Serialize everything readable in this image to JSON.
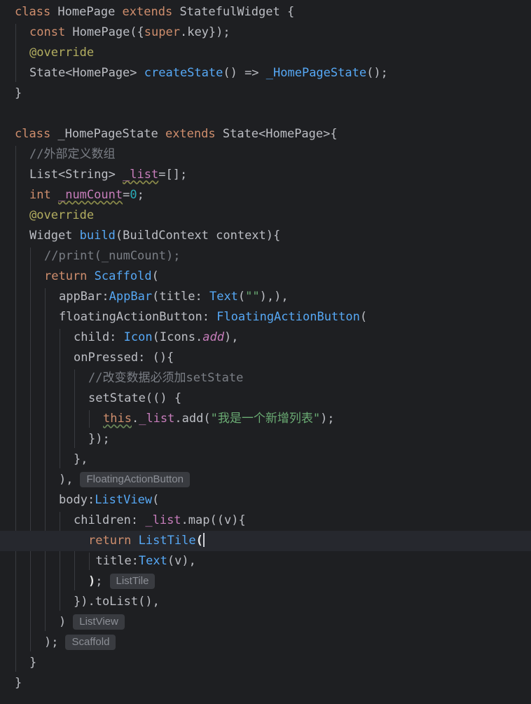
{
  "editor": {
    "lines": [
      {
        "indent": 0,
        "tokens": [
          [
            "kw",
            "class"
          ],
          [
            "plain",
            " HomePage "
          ],
          [
            "kw",
            "extends"
          ],
          [
            "plain",
            " StatefulWidget {"
          ]
        ]
      },
      {
        "indent": 1,
        "tokens": [
          [
            "kw",
            "const"
          ],
          [
            "plain",
            " HomePage({"
          ],
          [
            "kw",
            "super"
          ],
          [
            "plain",
            ".key});"
          ]
        ]
      },
      {
        "indent": 1,
        "tokens": [
          [
            "anno",
            "@override"
          ]
        ]
      },
      {
        "indent": 1,
        "tokens": [
          [
            "plain",
            "State<HomePage> "
          ],
          [
            "fn",
            "createState"
          ],
          [
            "plain",
            "() => "
          ],
          [
            "cls",
            "_HomePageState"
          ],
          [
            "plain",
            "();"
          ]
        ]
      },
      {
        "indent": 0,
        "tokens": [
          [
            "plain",
            "}"
          ]
        ]
      },
      {
        "indent": 0,
        "tokens": []
      },
      {
        "indent": 0,
        "tokens": [
          [
            "kw",
            "class"
          ],
          [
            "plain",
            " _HomePageState "
          ],
          [
            "kw",
            "extends"
          ],
          [
            "plain",
            " State<HomePage>{"
          ]
        ]
      },
      {
        "indent": 1,
        "tokens": [
          [
            "comment",
            "//外部定义数组"
          ]
        ]
      },
      {
        "indent": 1,
        "tokens": [
          [
            "plain",
            "List<String> "
          ],
          [
            "warnfield",
            "_list"
          ],
          [
            "plain",
            "=[];"
          ]
        ]
      },
      {
        "indent": 1,
        "tokens": [
          [
            "kw",
            "int"
          ],
          [
            "plain",
            " "
          ],
          [
            "warnfield",
            "_numCount"
          ],
          [
            "plain",
            "="
          ],
          [
            "num",
            "0"
          ],
          [
            "plain",
            ";"
          ]
        ]
      },
      {
        "indent": 1,
        "tokens": [
          [
            "anno",
            "@override"
          ]
        ]
      },
      {
        "indent": 1,
        "tokens": [
          [
            "plain",
            "Widget "
          ],
          [
            "fn",
            "build"
          ],
          [
            "plain",
            "(BuildContext context){"
          ]
        ]
      },
      {
        "indent": 2,
        "tokens": [
          [
            "comment",
            "//print(_numCount);"
          ]
        ]
      },
      {
        "indent": 2,
        "tokens": [
          [
            "kw",
            "return"
          ],
          [
            "plain",
            " "
          ],
          [
            "cls",
            "Scaffold"
          ],
          [
            "plain",
            "("
          ]
        ]
      },
      {
        "indent": 3,
        "tokens": [
          [
            "plain",
            "appBar:"
          ],
          [
            "cls",
            "AppBar"
          ],
          [
            "plain",
            "(title: "
          ],
          [
            "cls",
            "Text"
          ],
          [
            "plain",
            "("
          ],
          [
            "str",
            "\"\""
          ],
          [
            "plain",
            "),),"
          ]
        ]
      },
      {
        "indent": 3,
        "tokens": [
          [
            "plain",
            "floatingActionButton: "
          ],
          [
            "cls",
            "FloatingActionButton"
          ],
          [
            "plain",
            "("
          ]
        ]
      },
      {
        "indent": 4,
        "tokens": [
          [
            "plain",
            "child: "
          ],
          [
            "cls",
            "Icon"
          ],
          [
            "plain",
            "(Icons."
          ],
          [
            "static",
            "add"
          ],
          [
            "plain",
            "),"
          ]
        ]
      },
      {
        "indent": 4,
        "tokens": [
          [
            "plain",
            "onPressed: (){"
          ]
        ]
      },
      {
        "indent": 5,
        "tokens": [
          [
            "comment",
            "//改变数据必须加setState"
          ]
        ]
      },
      {
        "indent": 5,
        "tokens": [
          [
            "plain",
            "setState(() {"
          ]
        ]
      },
      {
        "indent": 6,
        "tokens": [
          [
            "warnkw",
            "this"
          ],
          [
            "plain",
            "."
          ],
          [
            "field",
            "_list"
          ],
          [
            "plain",
            ".add("
          ],
          [
            "str",
            "\"我是一个新增列表\""
          ],
          [
            "plain",
            ");"
          ]
        ]
      },
      {
        "indent": 5,
        "tokens": [
          [
            "plain",
            "});"
          ]
        ]
      },
      {
        "indent": 4,
        "tokens": [
          [
            "plain",
            "},"
          ]
        ]
      },
      {
        "indent": 3,
        "tokens": [
          [
            "plain",
            "),"
          ]
        ],
        "hint": "FloatingActionButton"
      },
      {
        "indent": 3,
        "tokens": [
          [
            "plain",
            "body:"
          ],
          [
            "cls",
            "ListView"
          ],
          [
            "plain",
            "("
          ]
        ]
      },
      {
        "indent": 4,
        "tokens": [
          [
            "plain",
            "children: "
          ],
          [
            "field",
            "_list"
          ],
          [
            "plain",
            ".map((v){"
          ]
        ]
      },
      {
        "indent": 5,
        "tokens": [
          [
            "kw",
            "return"
          ],
          [
            "plain",
            " "
          ],
          [
            "cls",
            "ListTile"
          ],
          [
            "brackethl",
            "("
          ]
        ],
        "current": true
      },
      {
        "indent": 5.5,
        "tokens": [
          [
            "plain",
            "title:"
          ],
          [
            "cls",
            "Text"
          ],
          [
            "plain",
            "(v),"
          ]
        ]
      },
      {
        "indent": 5,
        "tokens": [
          [
            "brackethl",
            ")"
          ],
          [
            "plain",
            ";"
          ]
        ],
        "hint": "ListTile"
      },
      {
        "indent": 4,
        "tokens": [
          [
            "plain",
            "}).toList(),"
          ]
        ]
      },
      {
        "indent": 3,
        "tokens": [
          [
            "plain",
            ")"
          ]
        ],
        "hint": "ListView"
      },
      {
        "indent": 2,
        "tokens": [
          [
            "plain",
            ");"
          ]
        ],
        "hint": "Scaffold"
      },
      {
        "indent": 1,
        "tokens": [
          [
            "plain",
            "}"
          ]
        ]
      },
      {
        "indent": 0,
        "tokens": [
          [
            "plain",
            "}"
          ]
        ]
      }
    ]
  }
}
